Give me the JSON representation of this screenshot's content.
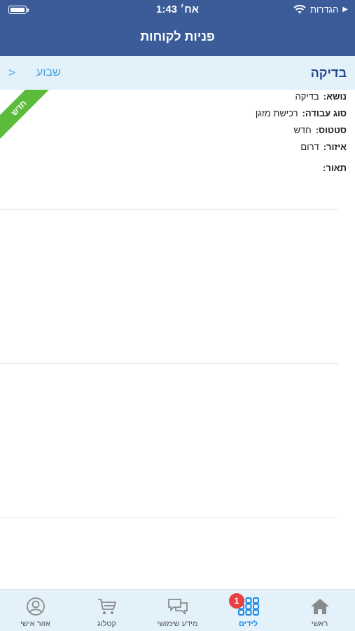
{
  "status_bar": {
    "time": "1:43 אח׳",
    "carrier": "הגדרות",
    "back_arrow": "▶"
  },
  "nav": {
    "title": "פניות לקוחות"
  },
  "item": {
    "title": "בדיקה",
    "date": "שבוע",
    "chevron": ">",
    "ribbon": "חדש"
  },
  "details": [
    {
      "label": "נושא:",
      "value": "בדיקה"
    },
    {
      "label": "סוג עבודה:",
      "value": "רכישת מזגן"
    },
    {
      "label": "סטטוס:",
      "value": "חדש"
    },
    {
      "label": "איזור:",
      "value": "דרום"
    },
    {
      "label": "תאור:",
      "value": ""
    }
  ],
  "tabs": [
    {
      "label": "ראשי",
      "icon": "home-icon",
      "active": false
    },
    {
      "label": "לידים",
      "icon": "grid-icon",
      "active": true,
      "badge": "1"
    },
    {
      "label": "מידע שימושי",
      "icon": "chat-icon",
      "active": false
    },
    {
      "label": "קטלוג",
      "icon": "cart-icon",
      "active": false
    },
    {
      "label": "אזור אישי",
      "icon": "user-icon",
      "active": false
    }
  ],
  "colors": {
    "header": "#3b5b99",
    "subheader_bg": "#e3f1fb",
    "accent": "#4aa2e0",
    "ribbon": "#5dbb3c",
    "badge": "#e84040"
  }
}
